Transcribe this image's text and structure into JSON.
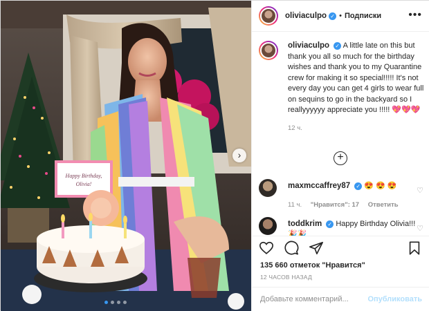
{
  "header": {
    "username": "oliviaculpo",
    "separator": "•",
    "follow_label": "Подписки",
    "more_label": "•••"
  },
  "caption": {
    "username": "oliviaculpo",
    "text": "A little late on this but thank you all so much for the birthday wishes and thank you to my Quarantine crew for making it so special!!!!! It's not every day you can get 4 girls to wear full on sequins to go in the backyard so I reallyyyyyy appreciate you !!!!! 💖💖💖",
    "time": "12 ч."
  },
  "load_more_label": "+",
  "comments": [
    {
      "username": "maxmccaffrey87",
      "text": "😍 😍 😍",
      "time": "11 ч.",
      "likes": "\"Нравится\": 17",
      "reply": "Ответить"
    },
    {
      "username": "toddkrim",
      "text": "Happy Birthday Olivia!!! 🎉🎉"
    }
  ],
  "stats": {
    "likes": "135 660 отметок \"Нравится\"",
    "time": "12 ЧАСОВ НАЗАД"
  },
  "comment_input": {
    "placeholder": "Добавьте комментарий...",
    "publish_label": "Опубликовать"
  },
  "photo": {
    "card_text": "Happy Birthday, Olivia!",
    "next_label": "›"
  },
  "icons": {
    "verified": "verified-badge-icon",
    "like": "heart-icon",
    "comment": "comment-icon",
    "share": "share-icon",
    "save": "bookmark-icon"
  },
  "colors": {
    "accent": "#3897f0",
    "publish_disabled": "#b2dffc",
    "muted": "#8e8e8e"
  }
}
